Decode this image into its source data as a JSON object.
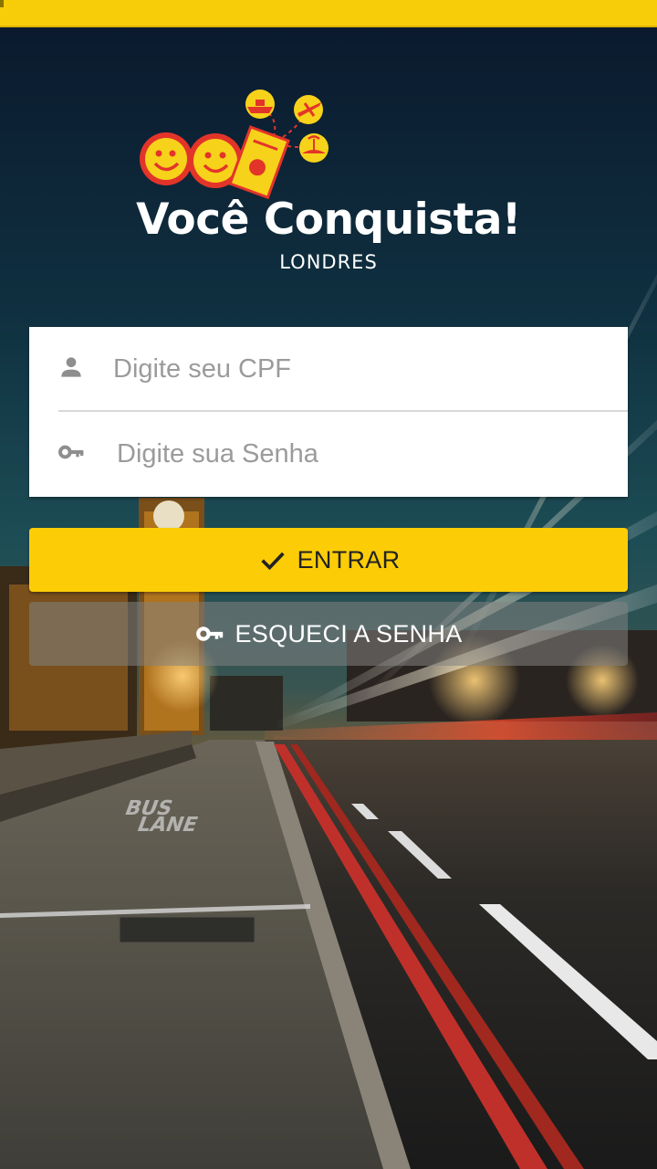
{
  "brand": {
    "title": "Você Conquista!",
    "subtitle": "LONDRES"
  },
  "login": {
    "cpf_placeholder": "Digite seu CPF",
    "password_placeholder": "Digite sua Senha",
    "enter_label": "ENTRAR",
    "forgot_label": "ESQUECI A SENHA"
  },
  "icons": {
    "cpf": "person-icon",
    "password": "key-icon",
    "enter": "check-icon",
    "forgot": "key-icon"
  },
  "colors": {
    "accent": "#fccd06",
    "status_bar": "#f7cd0a",
    "logo_red": "#e3342a",
    "logo_yellow": "#f7d21a"
  }
}
